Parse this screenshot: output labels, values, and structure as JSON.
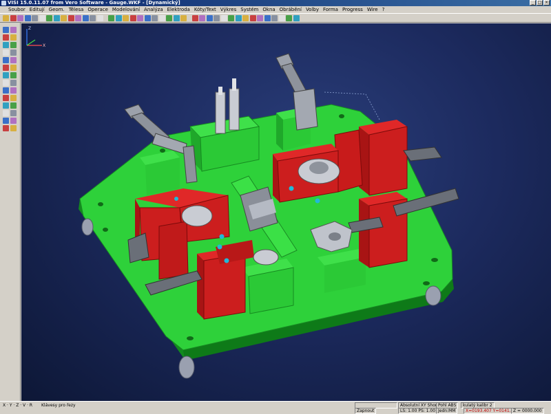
{
  "window": {
    "title": "VISI 15.0.11.07 from Vero Software - Gauge.WKF - [Dynamický]"
  },
  "menu": [
    "Soubor",
    "Editují",
    "Geom.",
    "Tělesa",
    "Operace",
    "Modelování",
    "Analýza",
    "Elektroda",
    "Kóty/Text",
    "Výkres",
    "Systém",
    "Okna",
    "Obrábění",
    "Volby",
    "Forma",
    "Progress",
    "Wire",
    "?"
  ],
  "statusbar": {
    "axes": "X · Y · Z · V · R",
    "hint": "Klávesy pro řezy",
    "coord_system": "Absolutní XY Shora",
    "pohl": "Pohl ABS",
    "color_label": "kulatý kalibr 2",
    "toggle": "Zapnout",
    "ls_ps": "LS: 1.00 PS: 1.00",
    "units": "Jedn:MM",
    "coords": "X=0193.407 Y=0141.636",
    "z": "Z = 0000.000"
  },
  "viewport": {
    "mode": "Dynamický"
  },
  "icons": {
    "toolbar_count": 40,
    "left_count": 28
  }
}
